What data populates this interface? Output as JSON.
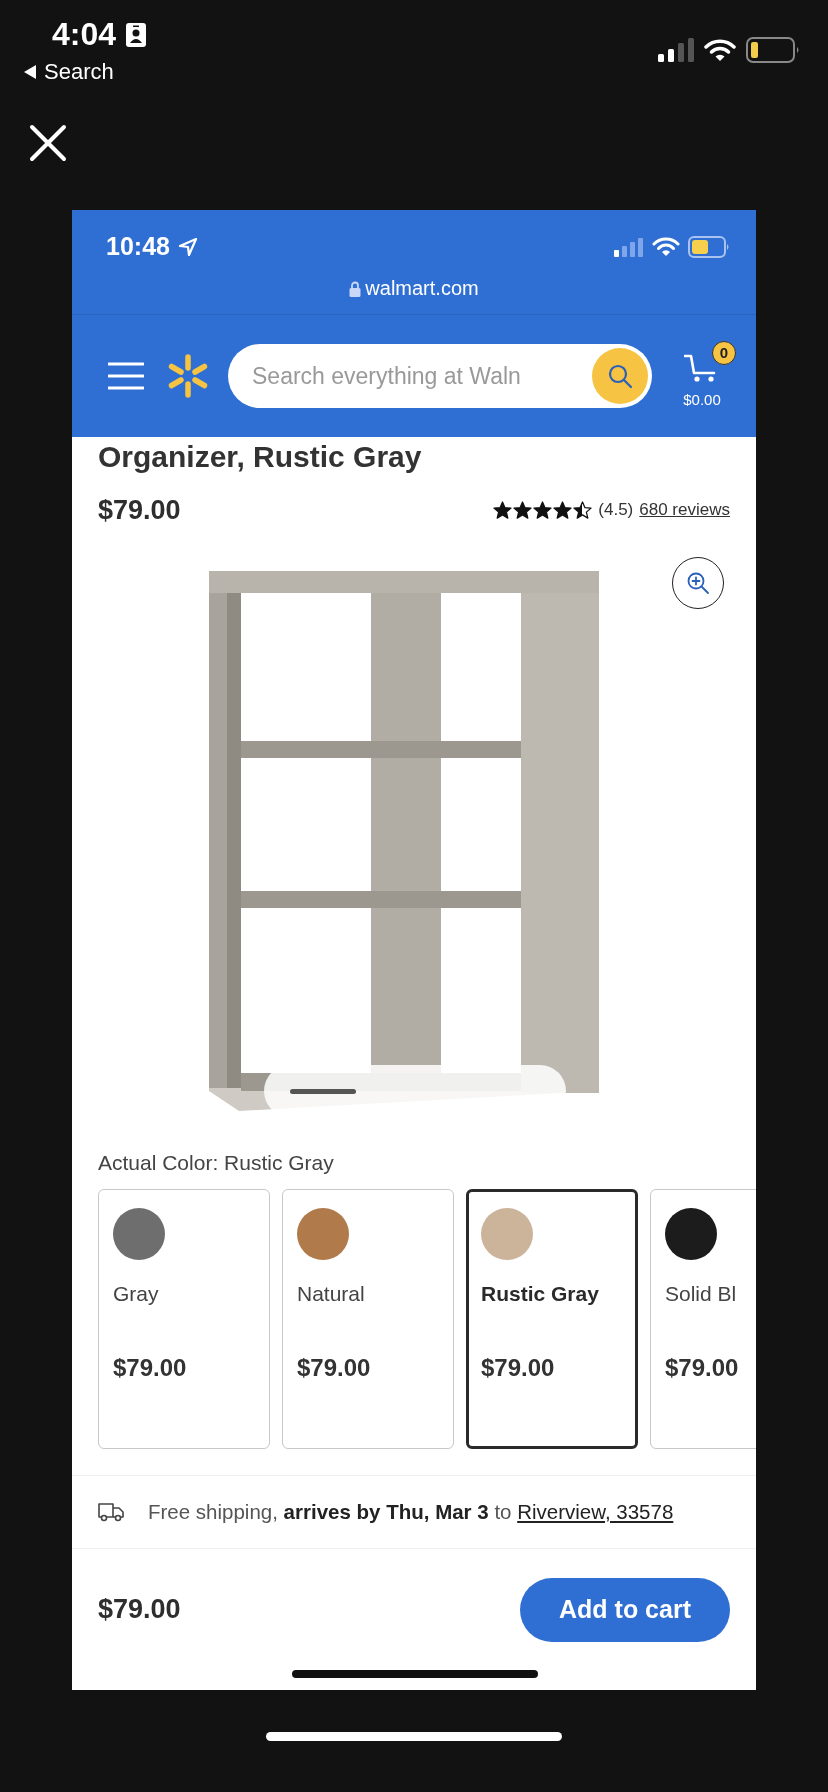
{
  "device_status": {
    "time": "4:04",
    "back_label": "Search"
  },
  "browser": {
    "time": "10:48",
    "url": "walmart.com"
  },
  "header": {
    "search_placeholder": "Search everything at Waln",
    "cart_count": "0",
    "cart_total": "$0.00"
  },
  "product": {
    "title": "Organizer, Rustic Gray",
    "price": "$79.00",
    "stars": 4.5,
    "rating": "(4.5)",
    "reviews": "680 reviews"
  },
  "color_label": "Actual Color: Rustic Gray",
  "swatches": [
    {
      "name": "Gray",
      "price": "$79.00",
      "color": "#6e6e6e",
      "selected": false
    },
    {
      "name": "Natural",
      "price": "$79.00",
      "color": "#b07a4a",
      "selected": false
    },
    {
      "name": "Rustic Gray",
      "price": "$79.00",
      "color": "#cbb49a",
      "selected": true
    },
    {
      "name": "Solid Bl",
      "price": "$79.00",
      "color": "#1c1c1c",
      "selected": false
    }
  ],
  "shipping": {
    "text": "Free shipping, **arrives by Thu, Mar 3** to ",
    "location": "Riverview, 33578"
  },
  "footer": {
    "price": "$79.00",
    "button": "Add to cart"
  }
}
